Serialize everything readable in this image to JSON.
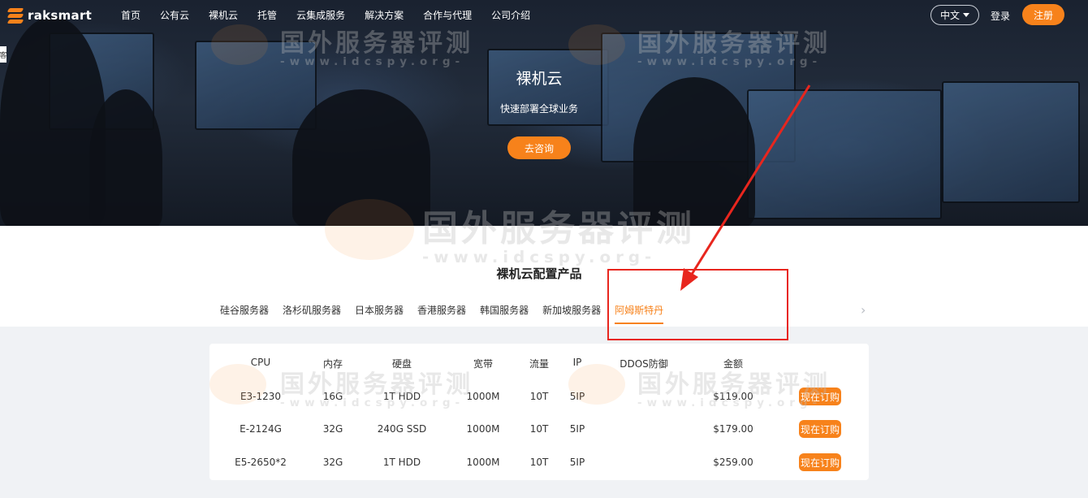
{
  "brand": {
    "name": "raksmart"
  },
  "nav": {
    "items": [
      "首页",
      "公有云",
      "裸机云",
      "托管",
      "云集成服务",
      "解决方案",
      "合作与代理",
      "公司介绍"
    ],
    "lang": "中文",
    "login": "登录",
    "register": "注册"
  },
  "side_tab": "客",
  "hero": {
    "title": "裸机云",
    "subtitle": "快速部署全球业务",
    "consult": "去咨询"
  },
  "section": {
    "title": "裸机云配置产品",
    "tabs": [
      "硅谷服务器",
      "洛杉矶服务器",
      "日本服务器",
      "香港服务器",
      "韩国服务器",
      "新加坡服务器",
      "阿姆斯特丹"
    ],
    "active_tab": "阿姆斯特丹"
  },
  "table": {
    "headers": [
      "CPU",
      "内存",
      "硬盘",
      "宽带",
      "流量",
      "IP",
      "DDOS防御",
      "金额"
    ],
    "rows": [
      {
        "cpu": "E3-1230",
        "ram": "16G",
        "disk": "1T HDD",
        "bandwidth": "1000M",
        "traffic": "10T",
        "ip": "5IP",
        "ddos": "",
        "price": "$119.00",
        "action": "现在订购"
      },
      {
        "cpu": "E-2124G",
        "ram": "32G",
        "disk": "240G SSD",
        "bandwidth": "1000M",
        "traffic": "10T",
        "ip": "5IP",
        "ddos": "",
        "price": "$179.00",
        "action": "现在订购"
      },
      {
        "cpu": "E5-2650*2",
        "ram": "32G",
        "disk": "1T HDD",
        "bandwidth": "1000M",
        "traffic": "10T",
        "ip": "5IP",
        "ddos": "",
        "price": "$259.00",
        "action": "现在订购"
      }
    ]
  },
  "watermark": {
    "text": "国外服务器评测",
    "url": "-www.idcspy.org-"
  },
  "colors": {
    "accent": "#f7821b",
    "annotation": "#e8261e"
  },
  "icons": {
    "logo": "raksmart-logo-icon",
    "caret": "caret-down-icon",
    "next": "chevron-right-icon"
  }
}
